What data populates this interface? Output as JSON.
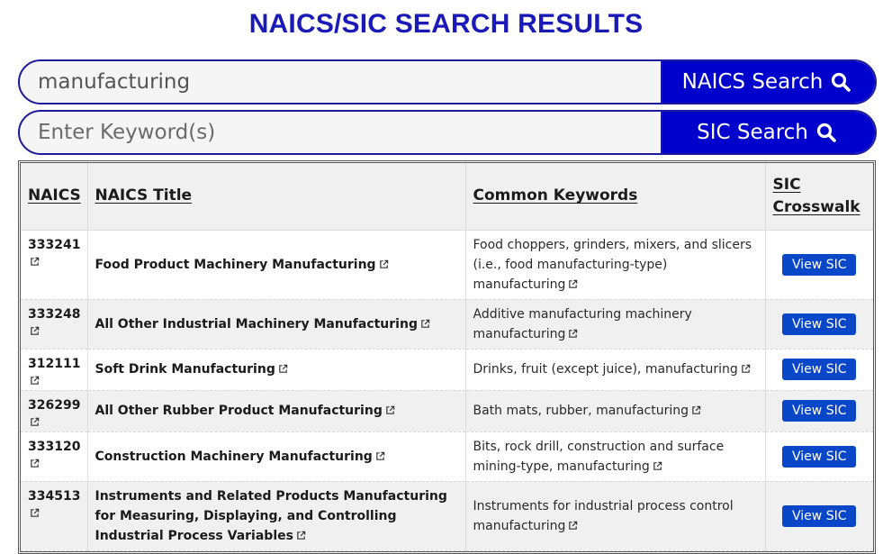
{
  "page": {
    "title": "NAICS/SIC SEARCH RESULTS"
  },
  "search": {
    "naics": {
      "value": "manufacturing",
      "placeholder": "Enter Keyword(s)",
      "button_label": "NAICS Search",
      "icon": "search-icon"
    },
    "sic": {
      "value": "",
      "placeholder": "Enter Keyword(s)",
      "button_label": "SIC Search",
      "icon": "search-icon"
    }
  },
  "colors": {
    "brand": "#0000cc",
    "title": "#1a1ab8",
    "view_button": "#0a47c8"
  },
  "table": {
    "headers": [
      "NAICS",
      "NAICS Title",
      "Common Keywords",
      "SIC Crosswalk"
    ],
    "rows": [
      {
        "code": "333241",
        "title": "Food Product Machinery Manufacturing",
        "keywords": "Food choppers, grinders, mixers, and slicers (i.e., food manufacturing-type) manufacturing",
        "action": "View SIC"
      },
      {
        "code": "333248",
        "title": "All Other Industrial Machinery Manufacturing",
        "keywords": "Additive manufacturing machinery manufacturing",
        "action": "View SIC"
      },
      {
        "code": "312111",
        "title": "Soft Drink Manufacturing",
        "keywords": "Drinks, fruit (except juice), manufacturing",
        "action": "View SIC"
      },
      {
        "code": "326299",
        "title": "All Other Rubber Product Manufacturing",
        "keywords": "Bath mats, rubber, manufacturing",
        "action": "View SIC"
      },
      {
        "code": "333120",
        "title": "Construction Machinery Manufacturing",
        "keywords": "Bits, rock drill, construction and surface mining-type, manufacturing",
        "action": "View SIC"
      },
      {
        "code": "334513",
        "title": "Instruments and Related Products Manufacturing for Measuring, Displaying, and Controlling Industrial Process Variables",
        "keywords": "Instruments for industrial process control manufacturing",
        "action": "View SIC"
      }
    ]
  }
}
